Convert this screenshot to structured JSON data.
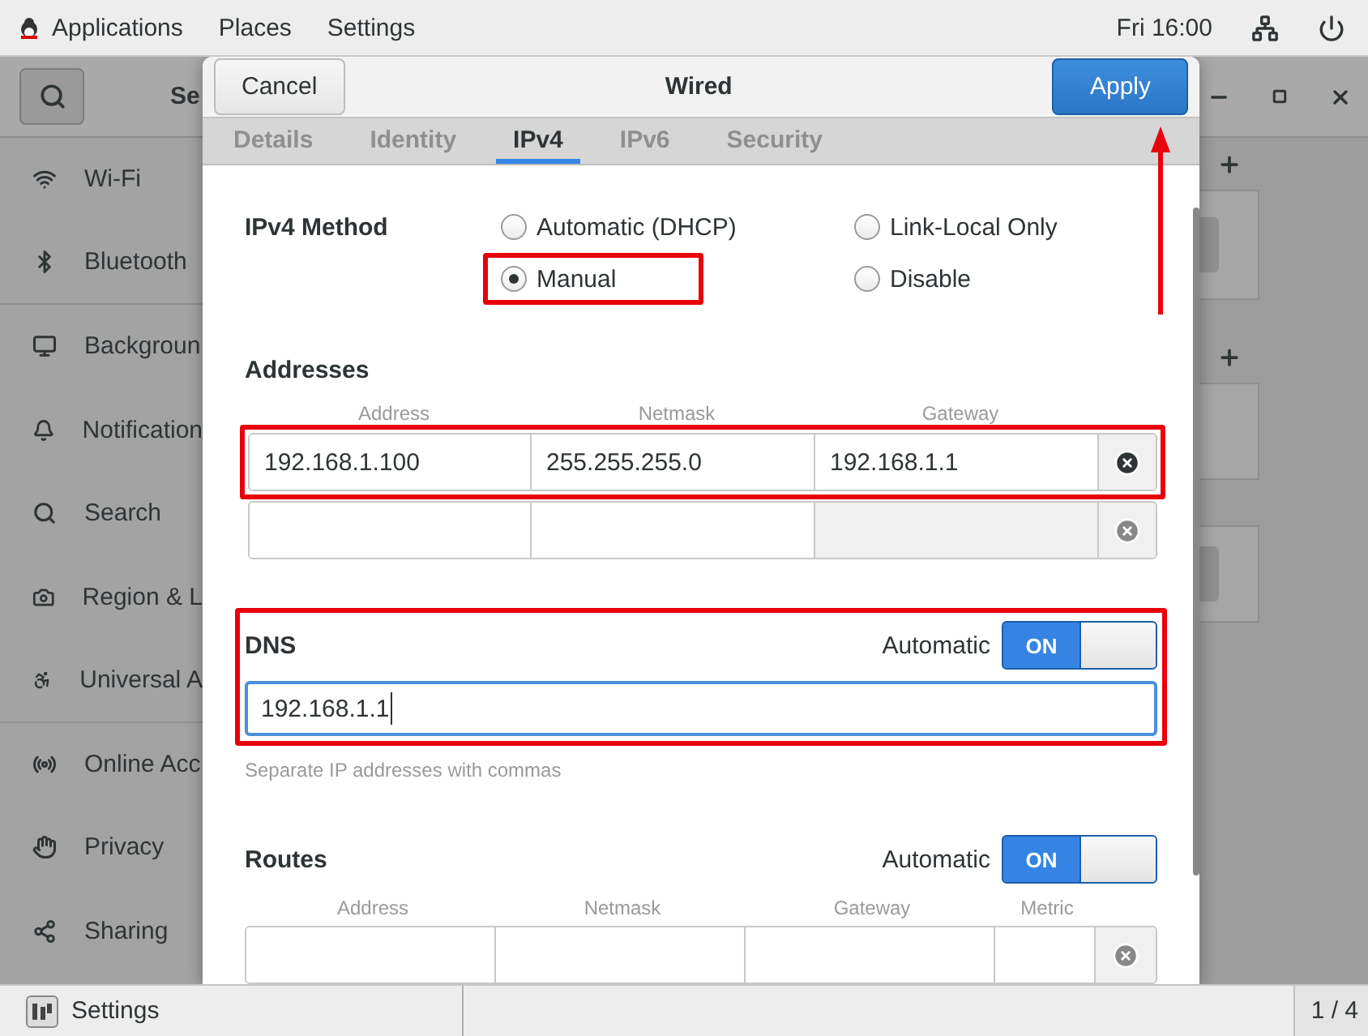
{
  "top_bar": {
    "menus": [
      "Applications",
      "Places",
      "Settings"
    ],
    "clock": "Fri 16:00"
  },
  "settings_window": {
    "title": "Se",
    "sidebar": [
      {
        "label": "Wi-Fi",
        "divider_after": false
      },
      {
        "label": "Bluetooth",
        "divider_after": true
      },
      {
        "label": "Backgroun",
        "divider_after": false
      },
      {
        "label": "Notification",
        "divider_after": false
      },
      {
        "label": "Search",
        "divider_after": false
      },
      {
        "label": "Region & L",
        "divider_after": false
      },
      {
        "label": "Universal A",
        "divider_after": true
      },
      {
        "label": "Online Acc",
        "divider_after": false
      },
      {
        "label": "Privacy",
        "divider_after": false
      },
      {
        "label": "Sharing",
        "divider_after": false
      }
    ]
  },
  "dialog": {
    "title": "Wired",
    "cancel": "Cancel",
    "apply": "Apply",
    "apply_arrow": true,
    "tabs": [
      {
        "label": "Details",
        "selected": false
      },
      {
        "label": "Identity",
        "selected": false
      },
      {
        "label": "IPv4",
        "selected": true
      },
      {
        "label": "IPv6",
        "selected": false
      },
      {
        "label": "Security",
        "selected": false
      }
    ],
    "ipv4_method": {
      "label": "IPv4 Method",
      "options": [
        {
          "label": "Automatic (DHCP)",
          "selected": false,
          "annotated": false
        },
        {
          "label": "Link-Local Only",
          "selected": false,
          "annotated": false
        },
        {
          "label": "Manual",
          "selected": true,
          "annotated": true
        },
        {
          "label": "Disable",
          "selected": false,
          "annotated": false
        }
      ]
    },
    "addresses": {
      "heading": "Addresses",
      "columns": [
        "Address",
        "Netmask",
        "Gateway"
      ],
      "rows": [
        {
          "kind": "filled",
          "address": "192.168.1.100",
          "netmask": "255.255.255.0",
          "gateway": "192.168.1.1",
          "annotated": true
        },
        {
          "kind": "blank",
          "annotated": false
        }
      ]
    },
    "dns": {
      "label": "DNS",
      "automatic_label": "Automatic",
      "automatic_on": true,
      "switch_text": "ON",
      "value": "192.168.1.1",
      "hint": "Separate IP addresses with commas",
      "annotated": true
    },
    "routes": {
      "heading": "Routes",
      "automatic_label": "Automatic",
      "automatic_on": true,
      "switch_text": "ON",
      "columns": [
        "Address",
        "Netmask",
        "Gateway",
        "Metric"
      ],
      "rows": [
        {
          "kind": "blank"
        }
      ]
    }
  },
  "taskbar": {
    "task": "Settings",
    "workspace": "1 / 4"
  }
}
